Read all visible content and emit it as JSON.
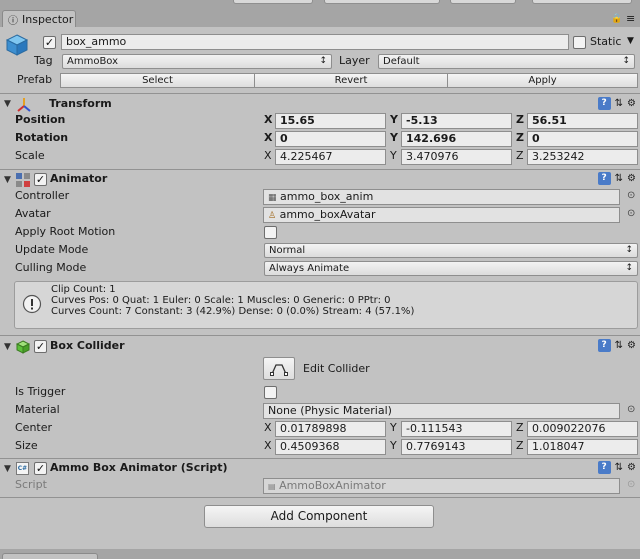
{
  "window": {
    "tab_title": "Inspector"
  },
  "header": {
    "active": true,
    "name": "box_ammo",
    "static_label": "Static",
    "static_checked": false,
    "tag_label": "Tag",
    "tag_value": "AmmoBox",
    "layer_label": "Layer",
    "layer_value": "Default",
    "prefab_label": "Prefab",
    "prefab_buttons": [
      "Select",
      "Revert",
      "Apply"
    ]
  },
  "transform": {
    "title": "Transform",
    "position_label": "Position",
    "position": {
      "x": "15.65",
      "y": "-5.13",
      "z": "56.51"
    },
    "rotation_label": "Rotation",
    "rotation": {
      "x": "0",
      "y": "142.696",
      "z": "0"
    },
    "scale_label": "Scale",
    "scale": {
      "x": "4.225467",
      "y": "3.470976",
      "z": "3.253242"
    }
  },
  "animator": {
    "title": "Animator",
    "enabled": true,
    "controller_label": "Controller",
    "controller_value": "ammo_box_anim",
    "avatar_label": "Avatar",
    "avatar_value": "ammo_boxAvatar",
    "apply_root_motion_label": "Apply Root Motion",
    "apply_root_motion": false,
    "update_mode_label": "Update Mode",
    "update_mode_value": "Normal",
    "culling_mode_label": "Culling Mode",
    "culling_mode_value": "Always Animate",
    "info_lines": [
      "Clip Count: 1",
      "Curves Pos: 0 Quat: 1 Euler: 0 Scale: 1 Muscles: 0 Generic: 0 PPtr: 0",
      "Curves Count: 7 Constant: 3 (42.9%) Dense: 0 (0.0%) Stream: 4 (57.1%)"
    ]
  },
  "box_collider": {
    "title": "Box Collider",
    "enabled": true,
    "edit_collider_label": "Edit Collider",
    "is_trigger_label": "Is Trigger",
    "is_trigger": false,
    "material_label": "Material",
    "material_value": "None (Physic Material)",
    "center_label": "Center",
    "center": {
      "x": "0.01789898",
      "y": "-0.111543",
      "z": "0.009022076"
    },
    "size_label": "Size",
    "size": {
      "x": "0.4509368",
      "y": "0.7769143",
      "z": "1.018047"
    }
  },
  "script_component": {
    "title": "Ammo Box Animator (Script)",
    "enabled": true,
    "script_label": "Script",
    "script_value": "AmmoBoxAnimator"
  },
  "add_component_label": "Add Component",
  "axis_labels": {
    "x": "X",
    "y": "Y",
    "z": "Z"
  },
  "icons": [
    "cube-icon",
    "lock-icon",
    "menu-icon",
    "help-book-icon",
    "preset-icon",
    "gear-icon",
    "transform-axes-icon",
    "animator-icon",
    "box-collider-icon",
    "script-icon",
    "info-icon",
    "object-picker-icon"
  ]
}
